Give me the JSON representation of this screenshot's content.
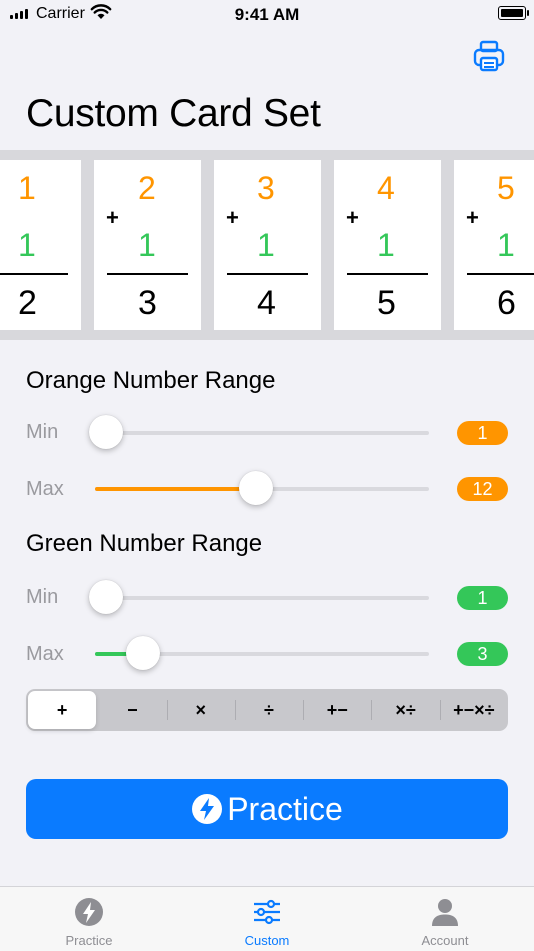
{
  "status_bar": {
    "carrier": "Carrier",
    "time": "9:41 AM"
  },
  "header": {
    "title": "Custom Card Set",
    "print_icon": "printer-icon"
  },
  "cards": [
    {
      "top": "1",
      "middle": "1",
      "answer": "2",
      "operator": ""
    },
    {
      "top": "2",
      "middle": "1",
      "answer": "3",
      "operator": "+"
    },
    {
      "top": "3",
      "middle": "1",
      "answer": "4",
      "operator": "+"
    },
    {
      "top": "4",
      "middle": "1",
      "answer": "5",
      "operator": "+"
    },
    {
      "top": "5",
      "middle": "1",
      "answer": "6",
      "operator": "+"
    }
  ],
  "orange_range": {
    "label": "Orange Number Range",
    "min": {
      "label": "Min",
      "value": "1",
      "position": 0.0
    },
    "max": {
      "label": "Max",
      "value": "12",
      "position": 0.48
    }
  },
  "green_range": {
    "label": "Green Number Range",
    "min": {
      "label": "Min",
      "value": "1",
      "position": 0.0
    },
    "max": {
      "label": "Max",
      "value": "3",
      "position": 0.12
    }
  },
  "operations": {
    "options": [
      "+",
      "−",
      "×",
      "÷",
      "+−",
      "×÷",
      "+−×÷"
    ],
    "selected": "+"
  },
  "practice_button": {
    "label": "Practice",
    "icon": "lightning-bolt-icon"
  },
  "tab_bar": {
    "tabs": [
      {
        "label": "Practice",
        "icon": "lightning-bolt-icon",
        "active": false
      },
      {
        "label": "Custom",
        "icon": "sliders-icon",
        "active": true
      },
      {
        "label": "Account",
        "icon": "person-icon",
        "active": false
      }
    ]
  },
  "colors": {
    "orange": "#ff9500",
    "green": "#34c759",
    "accent_blue": "#0a7bff",
    "tab_inactive": "#8e8e93"
  }
}
